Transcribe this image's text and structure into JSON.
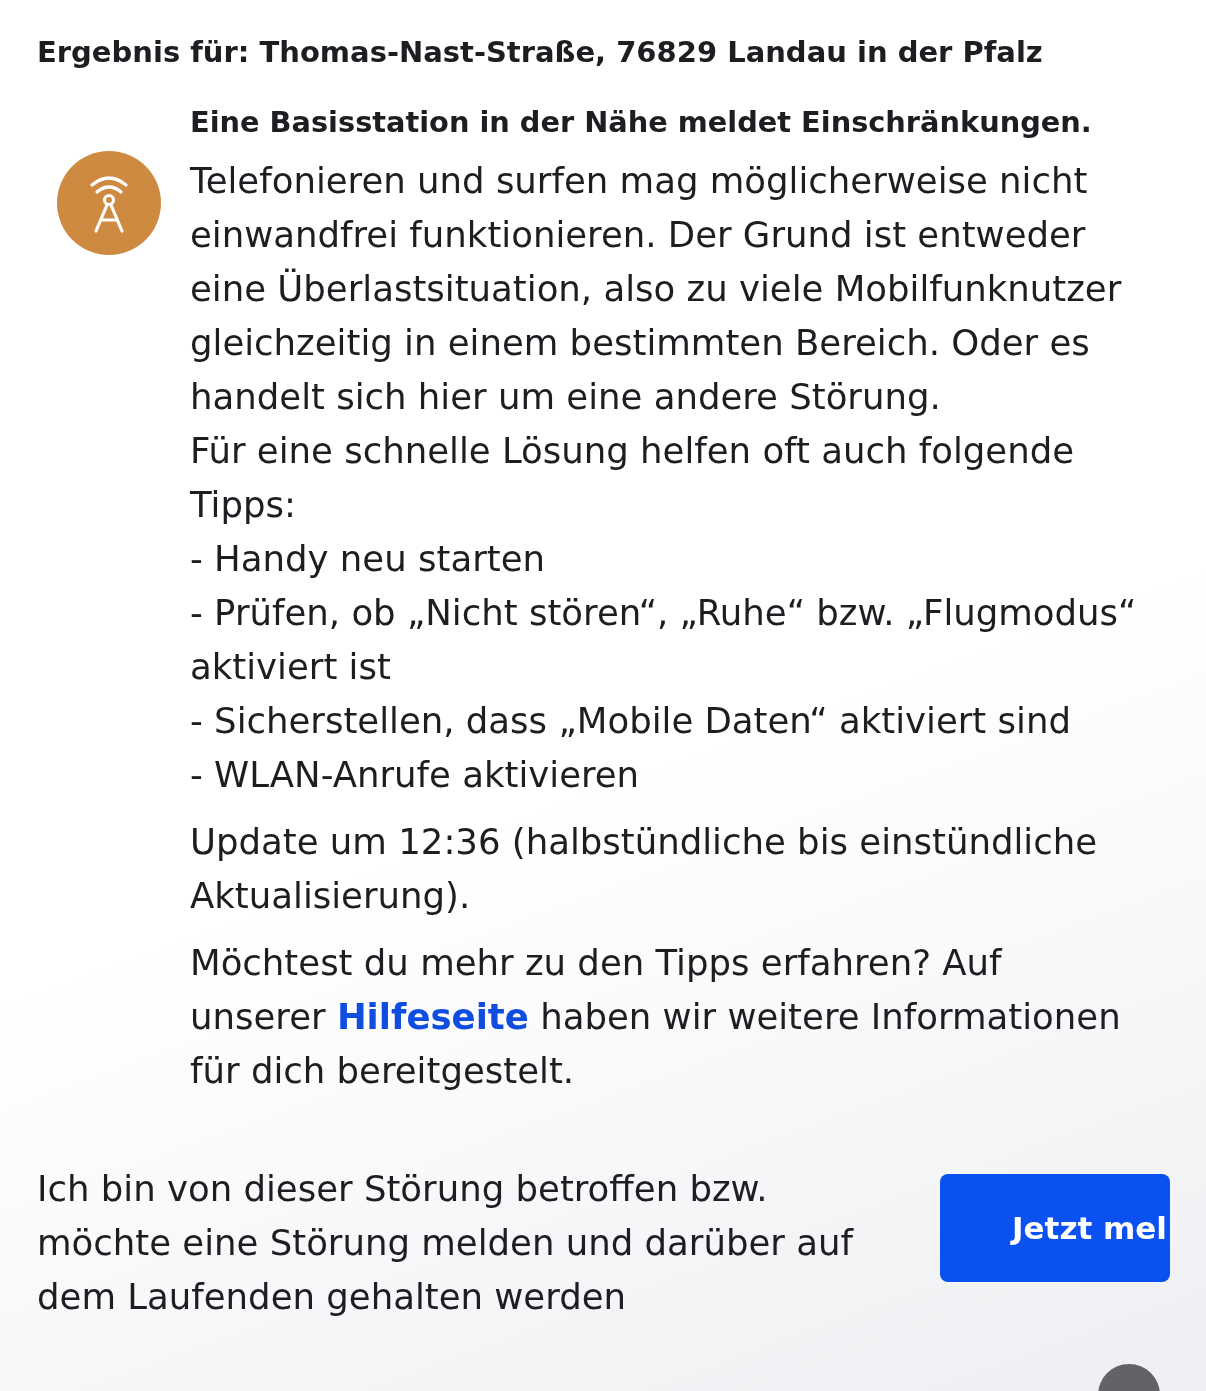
{
  "result_heading": "Ergebnis für: Thomas-Nast-Straße, 76829 Landau in der Pfalz",
  "status": {
    "title": "Eine Basisstation in der Nähe meldet Einschränkungen.",
    "description": "Telefonieren und surfen mag möglicherweise nicht einwandfrei funktionieren. Der Grund ist entweder eine Überlastsituation, also zu viele Mobilfunknutzer gleichzeitig in einem bestimmten Bereich. Oder es handelt sich hier um eine andere Störung.",
    "tips_intro": "Für eine schnelle Lösung helfen oft auch folgende Tipps:",
    "tips": [
      "- Handy neu starten",
      "- Prüfen, ob „Nicht stören“, „Ruhe“ bzw. „Flugmodus“ aktiviert ist",
      "- Sicherstellen, dass „Mobile Daten“ aktiviert sind",
      "- WLAN-Anrufe aktivieren"
    ],
    "update": "Update um 12:36 (halbstündliche bis einstündliche Aktualisierung).",
    "help": {
      "text_before": "Möchtest du mehr zu den Tipps erfahren? Auf unserer",
      "link": "Hilfeseite",
      "text_after": "haben wir weitere Informationen für dich bereitgestelt."
    }
  },
  "report": {
    "text": "Ich bin von dieser Störung betroffen bzw. möchte eine Störung melden und darüber auf dem Laufenden gehalten werden",
    "button": "Jetzt mel"
  }
}
